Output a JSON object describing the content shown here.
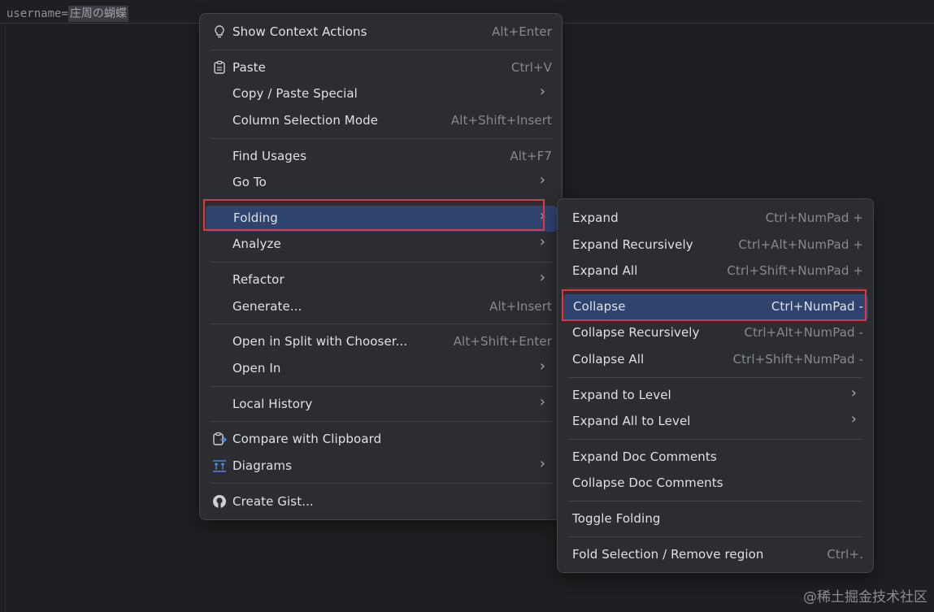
{
  "editor": {
    "key": "username=",
    "value": "庄周の蝴蝶"
  },
  "context_menu": {
    "show_context_actions": {
      "label": "Show Context Actions",
      "shortcut": "Alt+Enter"
    },
    "paste": {
      "label": "Paste",
      "shortcut": "Ctrl+V"
    },
    "copy_paste_special": {
      "label": "Copy / Paste Special"
    },
    "column_selection_mode": {
      "label": "Column Selection Mode",
      "shortcut": "Alt+Shift+Insert"
    },
    "find_usages": {
      "label": "Find Usages",
      "shortcut": "Alt+F7"
    },
    "go_to": {
      "label": "Go To"
    },
    "folding": {
      "label": "Folding"
    },
    "analyze": {
      "label": "Analyze"
    },
    "refactor": {
      "label": "Refactor"
    },
    "generate": {
      "label": "Generate...",
      "shortcut": "Alt+Insert"
    },
    "open_split": {
      "label": "Open in Split with Chooser...",
      "shortcut": "Alt+Shift+Enter"
    },
    "open_in": {
      "label": "Open In"
    },
    "local_history": {
      "label": "Local History"
    },
    "compare_clipboard": {
      "label": "Compare with Clipboard"
    },
    "diagrams": {
      "label": "Diagrams"
    },
    "create_gist": {
      "label": "Create Gist..."
    }
  },
  "folding_menu": {
    "expand": {
      "label": "Expand",
      "shortcut": "Ctrl+NumPad +"
    },
    "expand_recursively": {
      "label": "Expand Recursively",
      "shortcut": "Ctrl+Alt+NumPad +"
    },
    "expand_all": {
      "label": "Expand All",
      "shortcut": "Ctrl+Shift+NumPad +"
    },
    "collapse": {
      "label": "Collapse",
      "shortcut": "Ctrl+NumPad -"
    },
    "collapse_recursively": {
      "label": "Collapse Recursively",
      "shortcut": "Ctrl+Alt+NumPad -"
    },
    "collapse_all": {
      "label": "Collapse All",
      "shortcut": "Ctrl+Shift+NumPad -"
    },
    "expand_to_level": {
      "label": "Expand to Level"
    },
    "expand_all_to_level": {
      "label": "Expand All to Level"
    },
    "expand_doc_comments": {
      "label": "Expand Doc Comments"
    },
    "collapse_doc_comments": {
      "label": "Collapse Doc Comments"
    },
    "toggle_folding": {
      "label": "Toggle Folding"
    },
    "fold_selection": {
      "label": "Fold Selection / Remove region",
      "shortcut": "Ctrl+."
    }
  },
  "watermark": "@稀土掘金技术社区",
  "colors": {
    "selection": "#2e436e",
    "highlight_box": "#e0383e",
    "menu_bg": "#2b2d30",
    "editor_bg": "#1e1f22"
  }
}
